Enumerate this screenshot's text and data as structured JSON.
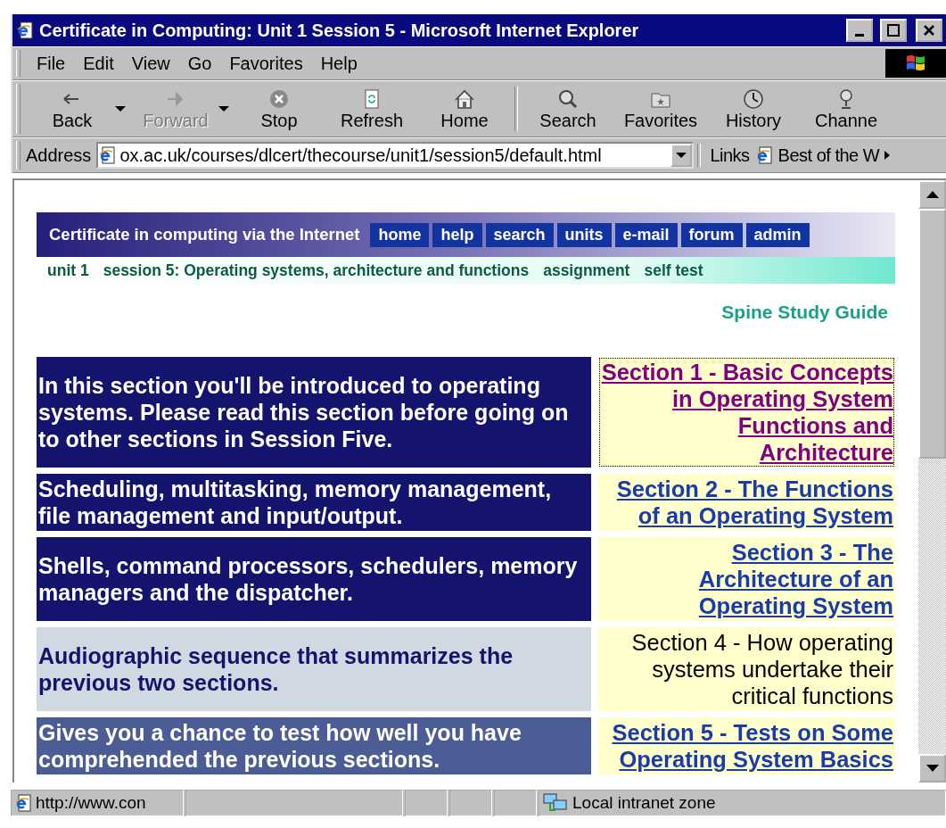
{
  "window": {
    "title": "Certificate in Computing: Unit 1 Session 5 - Microsoft Internet Explorer"
  },
  "menu": [
    "File",
    "Edit",
    "View",
    "Go",
    "Favorites",
    "Help"
  ],
  "toolbar": [
    {
      "kind": "back",
      "label": "Back",
      "disabled": false,
      "dropdown": true
    },
    {
      "kind": "forward",
      "label": "Forward",
      "disabled": true,
      "dropdown": true
    },
    {
      "kind": "stop",
      "label": "Stop",
      "disabled": false,
      "dropdown": false
    },
    {
      "kind": "refresh",
      "label": "Refresh",
      "disabled": false,
      "dropdown": false
    },
    {
      "kind": "home",
      "label": "Home",
      "disabled": false,
      "dropdown": false
    },
    {
      "kind": "search",
      "label": "Search",
      "disabled": false,
      "dropdown": false
    },
    {
      "kind": "favorites",
      "label": "Favorites",
      "disabled": false,
      "dropdown": false
    },
    {
      "kind": "history",
      "label": "History",
      "disabled": false,
      "dropdown": false
    },
    {
      "kind": "channels",
      "label": "Channe",
      "disabled": false,
      "dropdown": false
    }
  ],
  "address": {
    "label": "Address",
    "value": "ox.ac.uk/courses/dlcert/thecourse/unit1/session5/default.html"
  },
  "links": {
    "label": "Links",
    "item": "Best of the W"
  },
  "page": {
    "site_title": "Certificate in computing via the Internet",
    "nav_buttons": [
      "home",
      "help",
      "search",
      "units",
      "e-mail",
      "forum",
      "admin"
    ],
    "breadcrumb": [
      "unit 1",
      "session 5: Operating systems, architecture and functions",
      "assignment",
      "self test"
    ],
    "guide_title": "Spine Study Guide",
    "sections": [
      {
        "color": "#14146e",
        "description": "In this section you'll be introduced to operating systems. Please read this section before going on to other sections in Session Five.",
        "link": "Section 1 - Basic Concepts in Operating System Functions and Architecture",
        "kind": "link",
        "visited": true
      },
      {
        "color": "#14146e",
        "description": "Scheduling, multitasking, memory management, file management and input/output.",
        "link": "Section 2 - The Functions of an Operating System",
        "kind": "link",
        "visited": false
      },
      {
        "color": "#14146e",
        "description": "Shells, command processors, schedulers, memory managers and the dispatcher.",
        "link": "Section 3 - The Architecture of an Operating System",
        "kind": "link",
        "visited": false
      },
      {
        "color": "#d0d8e2",
        "description": "Audiographic sequence that summarizes the previous two sections.",
        "link": "Section 4 - How operating systems undertake their critical functions",
        "kind": "plain"
      },
      {
        "color": "#4c5c94",
        "description": "Gives you a chance to test how well you have comprehended the previous sections.",
        "link": "Section 5 - Tests on Some Operating System Basics",
        "kind": "link",
        "visited": false
      }
    ]
  },
  "status_bar": {
    "url": "http://www.con",
    "zone": "Local intranet zone"
  }
}
